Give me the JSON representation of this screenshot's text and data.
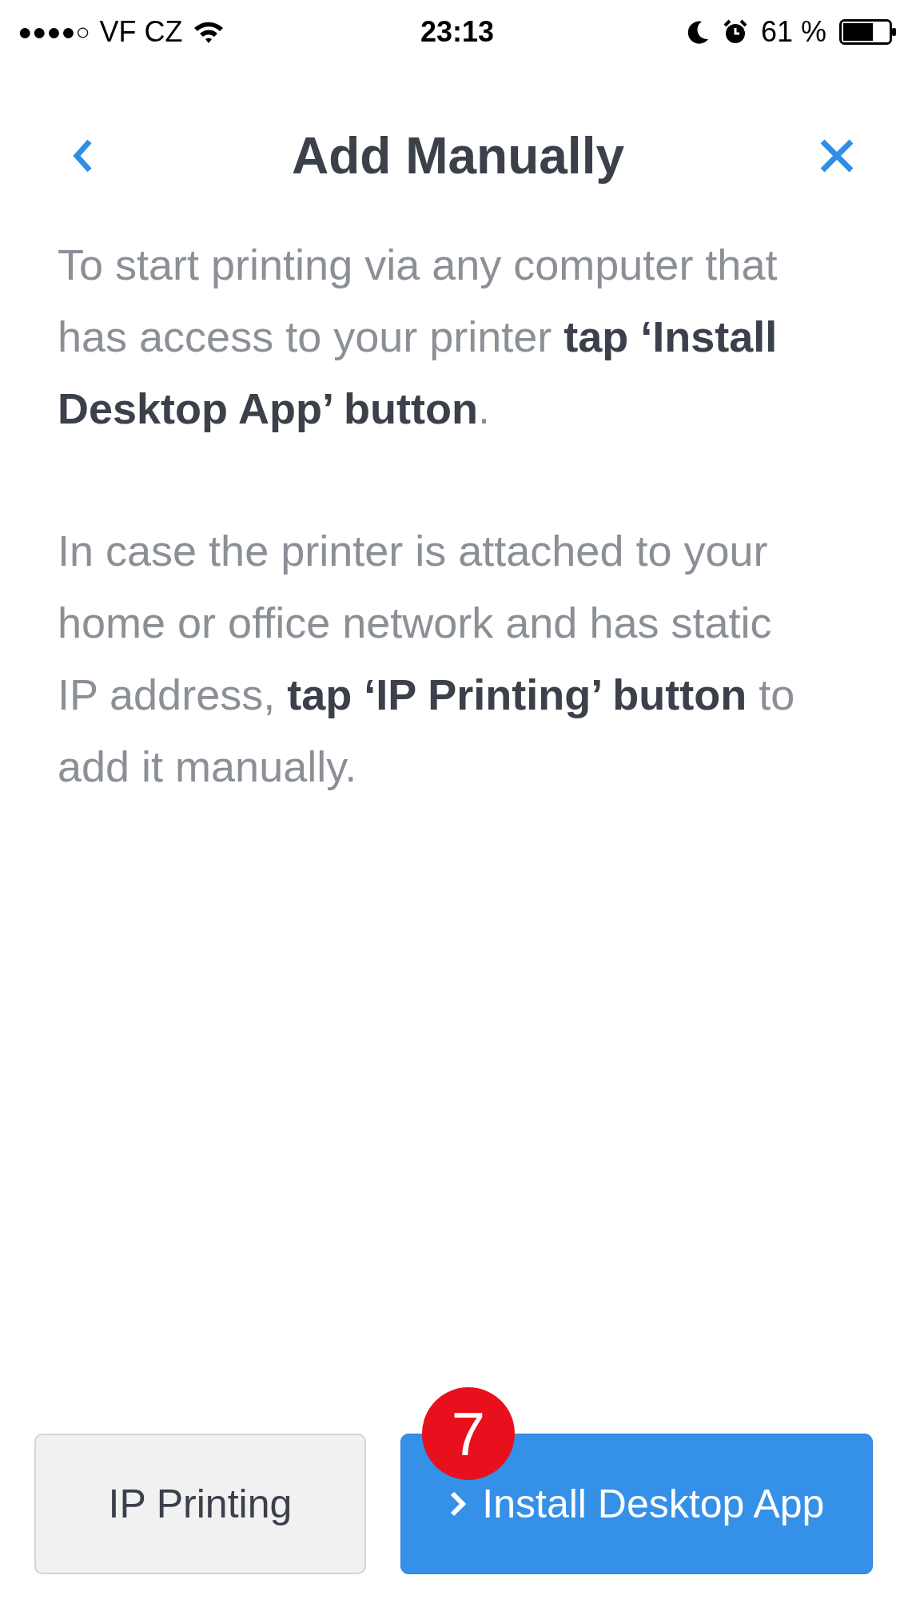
{
  "status_bar": {
    "signal": "●●●●○",
    "carrier": "VF CZ",
    "time": "23:13",
    "battery": "61 %"
  },
  "header": {
    "title": "Add Manually"
  },
  "paragraphs": [
    "To start printing via any computer that has access to your printer **tap ‘Install Desktop App’ button**.",
    "In case the printer is attached to your home or office network and has static IP address, **tap ‘IP Printing’ button** to add it manually."
  ],
  "buttons": [
    {
      "label": "IP Printing",
      "kind": "secondary"
    },
    {
      "label": "Install Desktop App",
      "kind": "primary",
      "badge": "7"
    }
  ]
}
